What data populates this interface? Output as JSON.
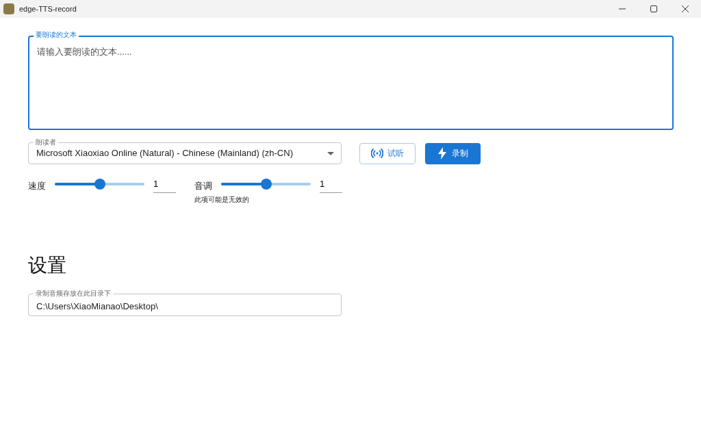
{
  "window": {
    "title": "edge-TTS-record"
  },
  "text_input": {
    "label": "要朗读的文本",
    "placeholder": "请输入要朗读的文本......",
    "focused": true
  },
  "voice_select": {
    "label": "朗读者",
    "value": "Microsoft Xiaoxiao Online (Natural) - Chinese (Mainland) (zh-CN)"
  },
  "buttons": [
    {
      "kind": "outlined",
      "label": "试听"
    },
    {
      "kind": "filled",
      "label": "录制"
    }
  ],
  "sliders": [
    {
      "label": "速度",
      "level": 0.5,
      "value": "1"
    },
    {
      "label": "音调",
      "level": 0.5,
      "value": "1",
      "hint": "此项可能是无效的"
    }
  ],
  "settings": {
    "title": "设置",
    "folder_field": {
      "label": "录制音频存放在此目录下",
      "value": "C:\\Users\\XiaoMianao\\Desktop\\"
    }
  }
}
